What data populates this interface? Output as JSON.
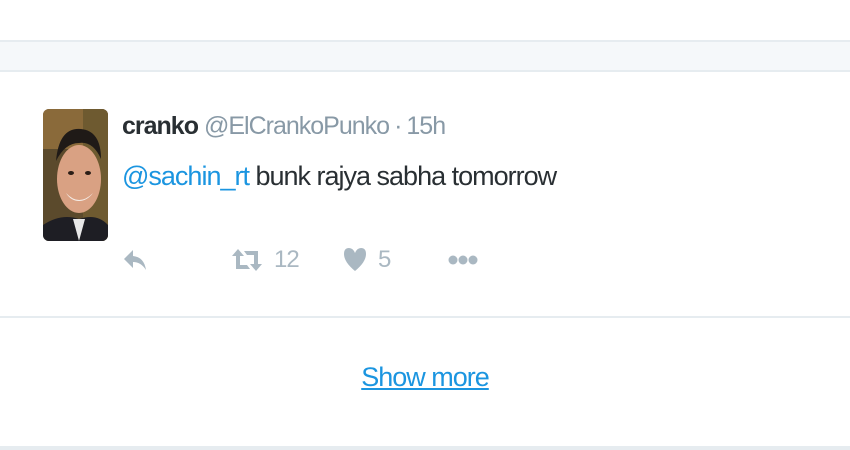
{
  "tweet": {
    "display_name": "cranko",
    "handle": "@ElCrankoPunko",
    "separator": "·",
    "time": "15h",
    "mention": "@sachin_rt",
    "body": " bunk rajya sabha tomorrow",
    "actions": {
      "reply_icon": "reply-icon",
      "retweet_icon": "retweet-icon",
      "retweet_count": "12",
      "like_icon": "heart-icon",
      "like_count": "5",
      "more_icon": "more-dots-icon"
    }
  },
  "footer": {
    "show_more_label": "Show more"
  },
  "colors": {
    "accent": "#1b95e0",
    "muted": "#8899a6",
    "action_gray": "#aab8c2",
    "divider": "#e6ecf0",
    "band": "#f5f8fa"
  }
}
